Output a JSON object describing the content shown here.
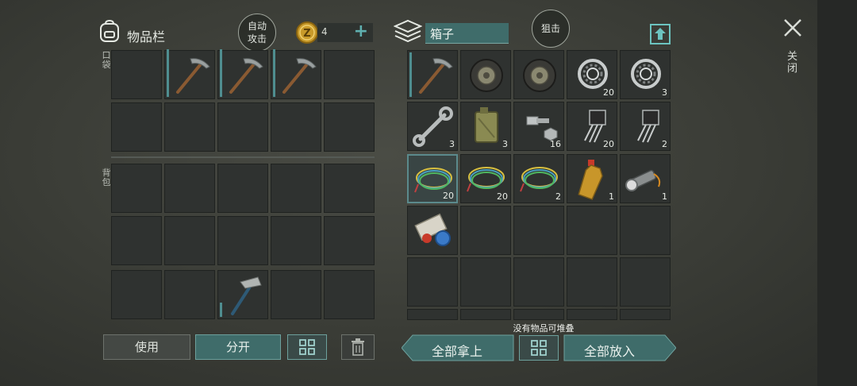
{
  "inventory": {
    "title": "物品栏",
    "auto_attack": "自动\n攻击",
    "coins": "4",
    "pocket_label": "口袋",
    "backpack_label": "背包",
    "pocket_slots": [
      {
        "icon": "",
        "qty": ""
      },
      {
        "icon": "pickaxe-icon",
        "qty": ""
      },
      {
        "icon": "pickaxe-icon",
        "qty": ""
      },
      {
        "icon": "pickaxe-icon",
        "qty": ""
      },
      {
        "icon": "",
        "qty": ""
      }
    ],
    "backpack_note": "hammer in row 3 col 3"
  },
  "chest": {
    "title": "箱子",
    "snipe": "狙击",
    "items": [
      {
        "icon": "pickaxe-icon",
        "qty": ""
      },
      {
        "icon": "wheel-icon",
        "qty": ""
      },
      {
        "icon": "wheel-icon",
        "qty": ""
      },
      {
        "icon": "bearing-icon",
        "qty": "20"
      },
      {
        "icon": "bearing-icon",
        "qty": "3"
      },
      {
        "icon": "wrench-icon",
        "qty": "3"
      },
      {
        "icon": "jerrycan-icon",
        "qty": "3"
      },
      {
        "icon": "bolt-icon",
        "qty": "16"
      },
      {
        "icon": "transistor-icon",
        "qty": "20"
      },
      {
        "icon": "transistor-icon",
        "qty": "2"
      },
      {
        "icon": "wire-icon",
        "qty": "20"
      },
      {
        "icon": "wire-icon",
        "qty": "20"
      },
      {
        "icon": "wire-icon",
        "qty": "2"
      },
      {
        "icon": "bottle-icon",
        "qty": "1"
      },
      {
        "icon": "flashlight-icon",
        "qty": "1"
      },
      {
        "icon": "blueprint-icon",
        "qty": ""
      }
    ],
    "no_stack_note": "没有物品可堆叠"
  },
  "buttons": {
    "use": "使用",
    "split": "分开",
    "take_all": "全部拿上",
    "put_all": "全部放入",
    "close": "关闭"
  },
  "colors": {
    "accent": "#3f6c6a",
    "bar": "#4f8e90"
  }
}
